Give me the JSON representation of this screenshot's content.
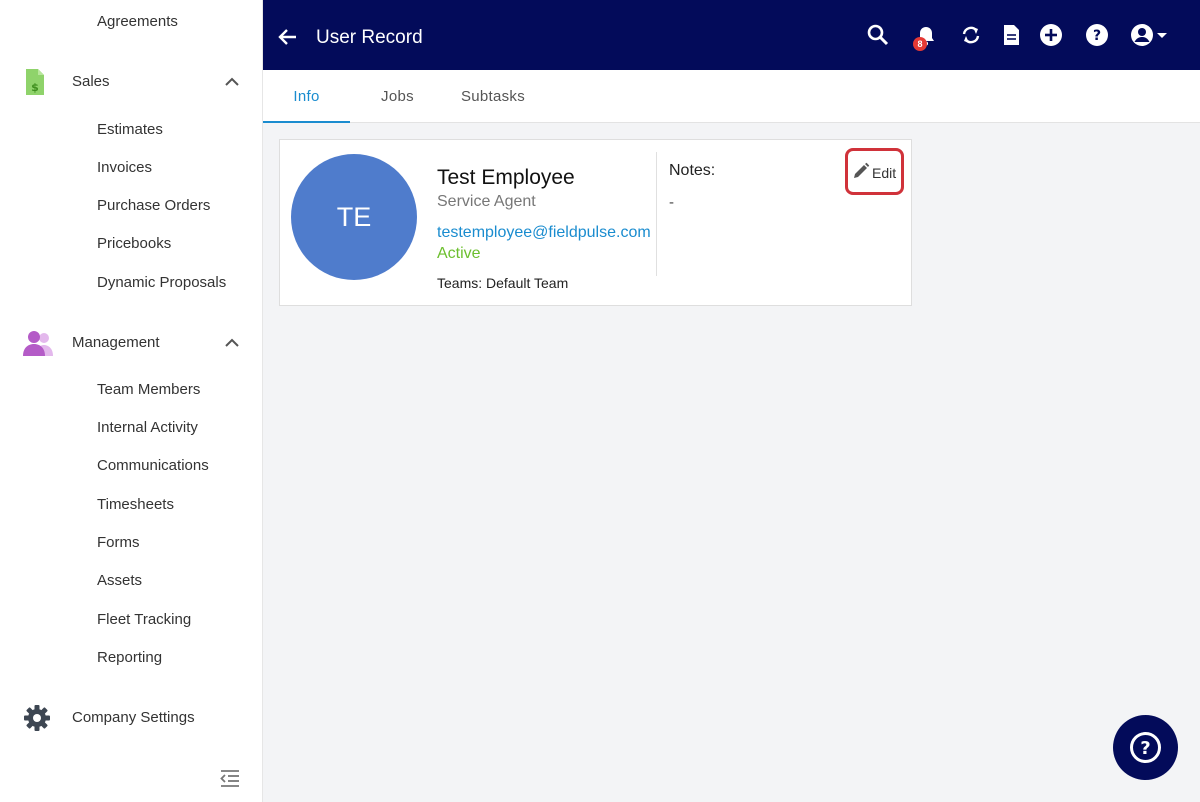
{
  "sidebar": {
    "top_item": "Agreements",
    "sales": {
      "label": "Sales",
      "icon": "dollar-document-icon",
      "items": [
        "Estimates",
        "Invoices",
        "Purchase Orders",
        "Pricebooks",
        "Dynamic Proposals"
      ]
    },
    "management": {
      "label": "Management",
      "icon": "users-icon",
      "items": [
        "Team Members",
        "Internal Activity",
        "Communications",
        "Timesheets",
        "Forms",
        "Assets",
        "Fleet Tracking",
        "Reporting"
      ]
    },
    "settings": {
      "label": "Company Settings",
      "icon": "gear-icon"
    }
  },
  "header": {
    "title": "User Record",
    "notification_count": "8",
    "icons": [
      "search-icon",
      "bell-icon",
      "sync-icon",
      "document-icon",
      "add-icon",
      "help-icon",
      "account-icon"
    ]
  },
  "tabs": [
    "Info",
    "Jobs",
    "Subtasks"
  ],
  "active_tab": "Info",
  "user": {
    "initials": "TE",
    "name": "Test Employee",
    "role": "Service Agent",
    "email": "testemployee@fieldpulse.com",
    "status": "Active",
    "teams": "Teams: Default Team"
  },
  "notes": {
    "label": "Notes:",
    "value": "-"
  },
  "edit_label": "Edit",
  "colors": {
    "header_bg": "#030b5a",
    "accent": "#1a8ccf",
    "status_active": "#6cbf2e",
    "avatar_bg": "#4f7ccc",
    "highlight": "#d0323a"
  }
}
